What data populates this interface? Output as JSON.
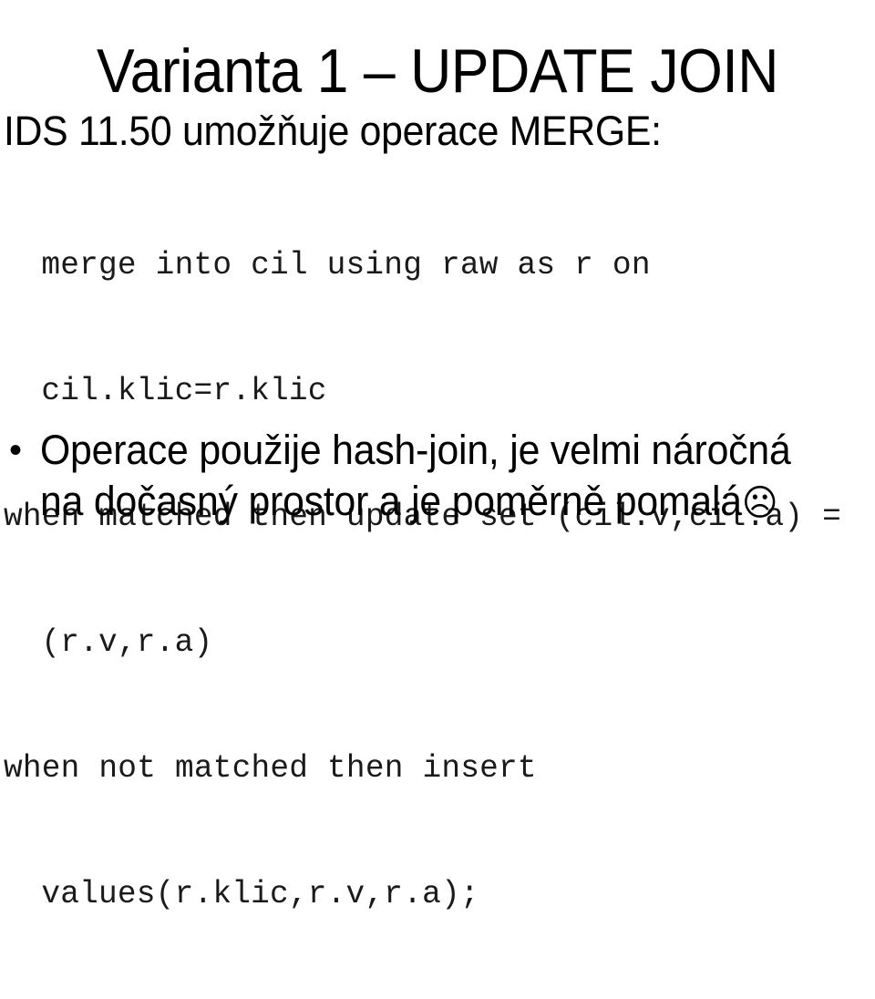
{
  "slide": {
    "title": "Varianta 1 – UPDATE JOIN",
    "lead": "IDS 11.50 umožňuje operace MERGE:",
    "code_lines": [
      {
        "text": "merge into cil using raw as r on",
        "indented": true
      },
      {
        "text": "cil.klic=r.klic",
        "indented": true
      },
      {
        "text": "when matched then update set (cil.v,cil.a) =",
        "indented": false
      },
      {
        "text": "(r.v,r.a)",
        "indented": true
      },
      {
        "text": "when not matched then insert",
        "indented": false
      },
      {
        "text": "values(r.klic,r.v,r.a);",
        "indented": true
      }
    ],
    "bullet": {
      "marker": "•",
      "text": "Operace použije hash-join, je velmi náročná na dočasný prostor a je poměrně pomalá",
      "trailing_symbol": "☹"
    },
    "colors": {
      "background": "#ffffff",
      "text": "#000000",
      "code_text": "#1a1a1a"
    }
  }
}
